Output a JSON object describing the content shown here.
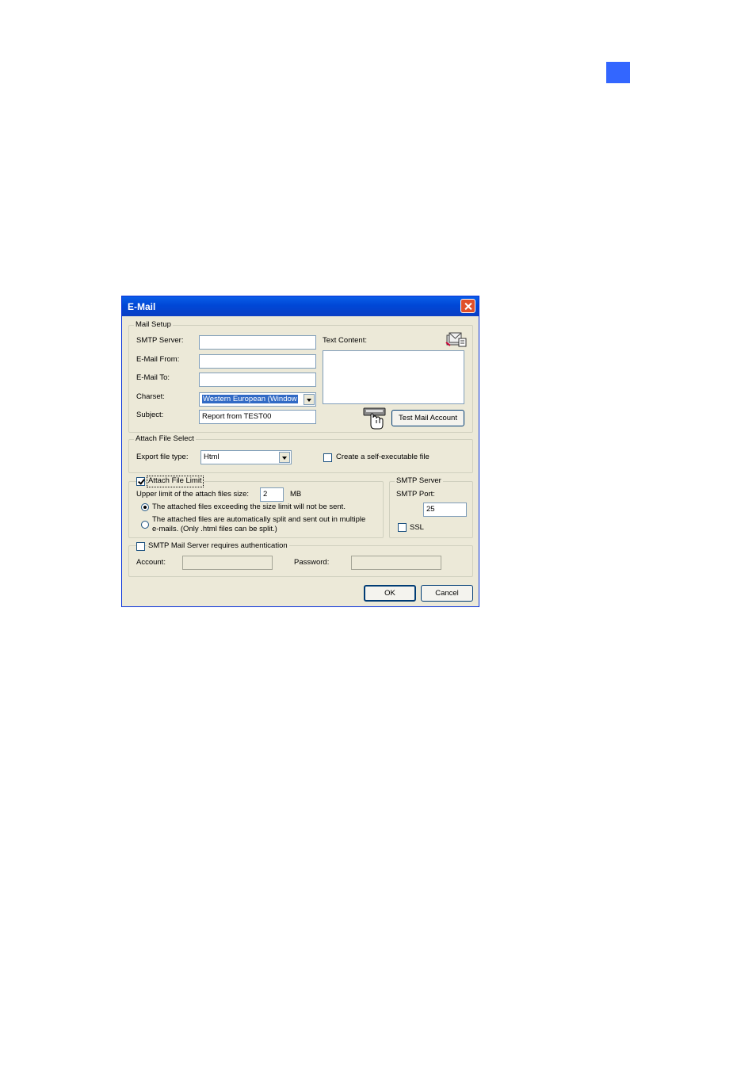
{
  "window": {
    "title": "E-Mail"
  },
  "mail_setup": {
    "group_title": "Mail Setup",
    "smtp_server_label": "SMTP Server:",
    "smtp_server_value": "",
    "email_from_label": "E-Mail From:",
    "email_from_value": "",
    "email_to_label": "E-Mail To:",
    "email_to_value": "",
    "charset_label": "Charset:",
    "charset_value": "Western European (Window",
    "subject_label": "Subject:",
    "subject_value": "Report from TEST00",
    "text_content_label": "Text Content:",
    "text_content_value": "",
    "test_button_label": "Test Mail Account"
  },
  "attach_file_select": {
    "group_title": "Attach File Select",
    "export_type_label": "Export file type:",
    "export_type_value": "Html",
    "self_exec_label": "Create a self-executable file",
    "self_exec_checked": false
  },
  "attach_file_limit": {
    "checkbox_label": "Attach File Limit",
    "checked": true,
    "upper_limit_label": "Upper limit of the attach files size:",
    "upper_limit_value": "2",
    "unit": "MB",
    "option_not_sent": "The attached files exceeding the size limit will not be sent.",
    "option_split_line1": "The attached files are automatically split and sent out in multiple",
    "option_split_line2": "e-mails. (Only .html files can be split.)",
    "selected_option": "not_sent"
  },
  "smtp_server": {
    "group_title": "SMTP Server",
    "port_label": "SMTP Port:",
    "port_value": "25",
    "ssl_label": "SSL",
    "ssl_checked": false
  },
  "auth": {
    "checkbox_label": "SMTP Mail Server requires authentication",
    "checked": false,
    "account_label": "Account:",
    "account_value": "",
    "password_label": "Password:",
    "password_value": ""
  },
  "buttons": {
    "ok": "OK",
    "cancel": "Cancel"
  },
  "icons": {
    "page_marker_color": "#3366ff",
    "mail_icon": "mail-envelope-icon",
    "hand_icon": "hand-pointer-icon"
  }
}
